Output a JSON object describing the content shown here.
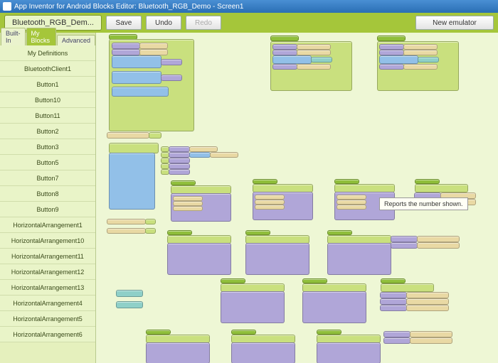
{
  "titlebar": {
    "text": "App Inventor for Android Blocks Editor: Bluetooth_RGB_Demo - Screen1"
  },
  "toolbar": {
    "project_tab": "Bluetooth_RGB_Dem...",
    "save": "Save",
    "undo": "Undo",
    "redo": "Redo",
    "new_emulator": "New emulator"
  },
  "side_tabs": {
    "builtin": "Built-In",
    "myblocks": "My Blocks",
    "advanced": "Advanced"
  },
  "sidebar_items": [
    "My Definitions",
    "BluetoothClient1",
    "Button1",
    "Button10",
    "Button11",
    "Button2",
    "Button3",
    "Button5",
    "Button7",
    "Button8",
    "Button9",
    "HorizontalArrangement1",
    "HorizontalArrangement10",
    "HorizontalArrangement11",
    "HorizontalArrangement12",
    "HorizontalArrangement13",
    "HorizontalArrangement4",
    "HorizontalArrangement5",
    "HorizontalArrangement6"
  ],
  "tooltip": {
    "text": "Reports the number shown."
  }
}
